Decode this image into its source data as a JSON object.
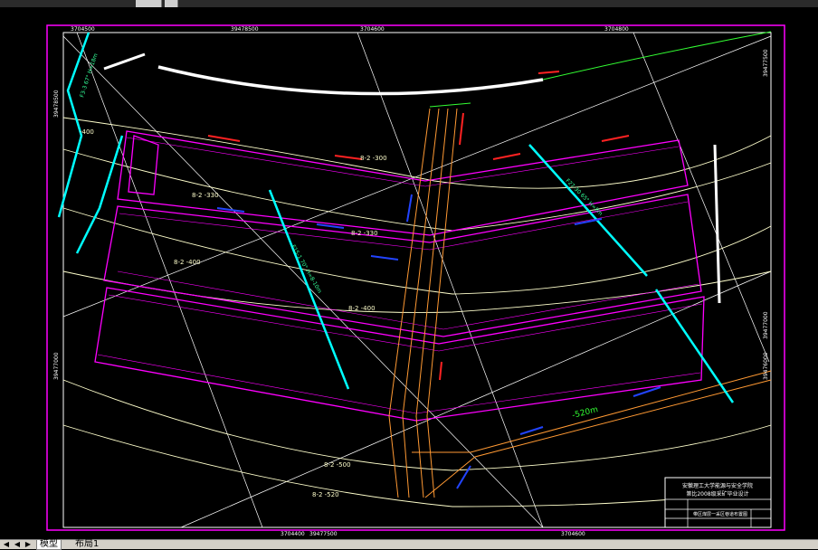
{
  "app": {
    "ui_colors": {
      "canvas": "#000000",
      "magenta": "#ff00ff",
      "yellow": "#ffffcc",
      "cyan": "#00ffff",
      "orange": "#ff9933",
      "green": "#33ff33",
      "red": "#ff2222",
      "blue": "#2244ff"
    }
  },
  "coords": {
    "top_1": "3704500",
    "top_2": "39478500",
    "top_3": "3704600",
    "top_4": "3704800",
    "right_top": "39477500",
    "left_top": "39478500",
    "left_bottom": "39477000",
    "right_mid": "39477000",
    "right_bottom": "39476000",
    "bottom_1": "3704400",
    "bottom_2": "39477500",
    "bottom_3": "3704600"
  },
  "labels": {
    "b300": "8-2 -300",
    "b330": "8-2 -330",
    "b330b": "8-2 -330",
    "b400": "8-2 -400",
    "b400b": "8-2 -400",
    "b500": "8-2 -500",
    "b520": "8-2 -520",
    "lm400": "-400",
    "green_520": "-520m",
    "cyan_left": "F3-3 67° H=18m",
    "cyan_mid": "F15-1 70° H=8-10m",
    "cyan_right": "F27-30 65° H=8m"
  },
  "title_block": {
    "line1": "安徽理工大学能源与安全学院",
    "line2": "第比2008级采矿毕业设计",
    "drawing_title": "带区煤层一采区巷道布置图"
  },
  "layout_tabs": {
    "model": "模型",
    "layout1": "布局1"
  }
}
